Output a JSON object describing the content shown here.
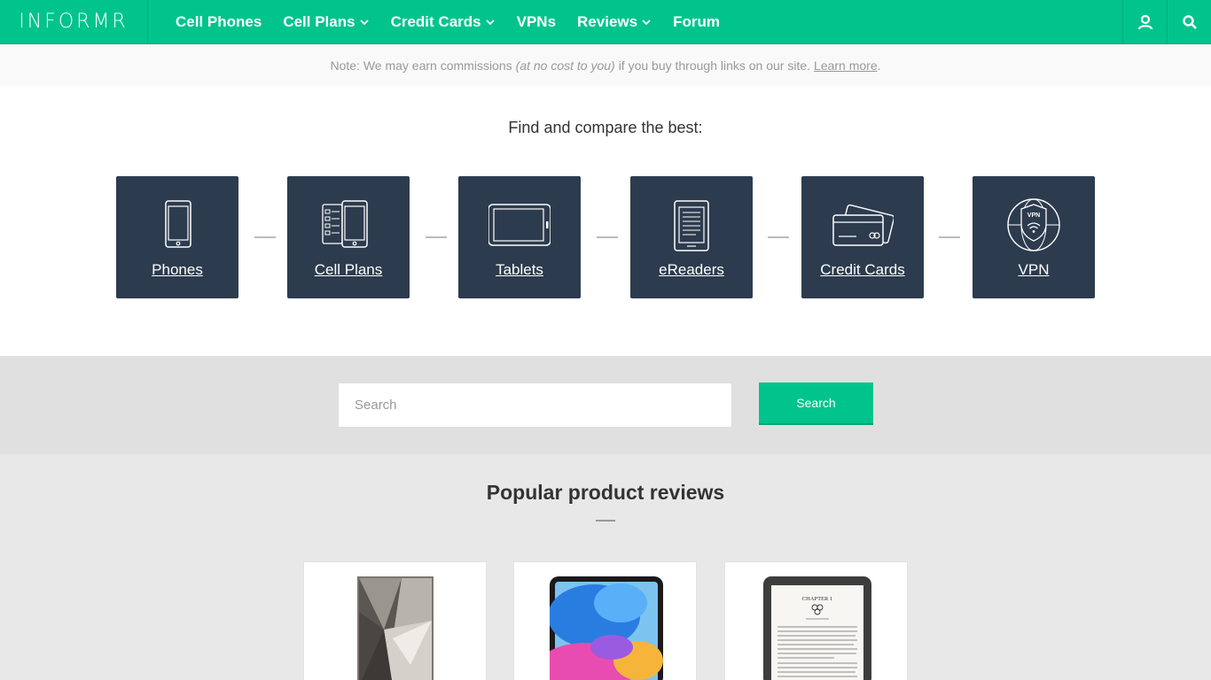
{
  "brand": {
    "logo": "INFORMR",
    "accent": "#00c48c",
    "tile_bg": "#2d3b4e"
  },
  "nav": {
    "items": [
      {
        "label": "Cell Phones",
        "has_dropdown": false
      },
      {
        "label": "Cell Plans",
        "has_dropdown": true
      },
      {
        "label": "Credit Cards",
        "has_dropdown": true
      },
      {
        "label": "VPNs",
        "has_dropdown": false
      },
      {
        "label": "Reviews",
        "has_dropdown": true
      },
      {
        "label": "Forum",
        "has_dropdown": false
      }
    ],
    "user_icon": "user-icon",
    "search_icon": "search-icon"
  },
  "note": {
    "prefix": "Note: We may earn commissions",
    "emphasis": "(at no cost to you)",
    "suffix": "if you buy through links on our site.",
    "link": "Learn more",
    "end": "."
  },
  "compare": {
    "title": "Find and compare the best:",
    "tiles": [
      {
        "label": "Phones",
        "icon": "phone-icon"
      },
      {
        "label": "Cell Plans",
        "icon": "cell-plans-icon"
      },
      {
        "label": "Tablets",
        "icon": "tablet-icon"
      },
      {
        "label": "eReaders",
        "icon": "ereader-icon"
      },
      {
        "label": "Credit Cards",
        "icon": "credit-cards-icon"
      },
      {
        "label": "VPN",
        "icon": "vpn-icon",
        "icon_text": "VPN"
      }
    ]
  },
  "search": {
    "placeholder": "Search",
    "button_label": "Search"
  },
  "popular": {
    "title": "Popular product reviews",
    "cards": [
      {
        "image": "smartphone-image"
      },
      {
        "image": "tablet-image"
      },
      {
        "image": "ereader-image",
        "chapter_text": "CHAPTER 1"
      }
    ]
  }
}
